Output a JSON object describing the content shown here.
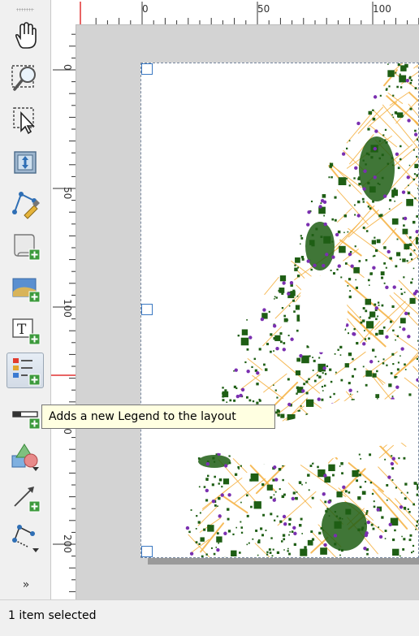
{
  "toolbar": {
    "tools": [
      {
        "name": "pan-icon",
        "active": false
      },
      {
        "name": "zoom-icon",
        "active": false
      },
      {
        "name": "select-move-icon",
        "active": false
      },
      {
        "name": "move-item-content-icon",
        "active": false
      },
      {
        "name": "edit-nodes-icon",
        "active": false
      },
      {
        "name": "add-map-icon",
        "active": false
      },
      {
        "name": "add-picture-icon",
        "active": false
      },
      {
        "name": "add-label-icon",
        "active": false
      },
      {
        "name": "add-legend-icon",
        "active": true
      },
      {
        "name": "add-scalebar-icon",
        "active": false
      },
      {
        "name": "add-shape-icon",
        "active": false
      },
      {
        "name": "add-arrow-icon",
        "active": false
      },
      {
        "name": "add-node-item-icon",
        "active": false
      }
    ],
    "more_label": "»"
  },
  "rulers": {
    "horizontal_labels": [
      "0",
      "50",
      "100"
    ],
    "vertical_labels": [
      "0",
      "50",
      "100",
      "150",
      "200"
    ]
  },
  "tooltip": {
    "text": "Adds a new Legend to the layout"
  },
  "status": {
    "text": "1 item selected"
  },
  "colors": {
    "accent": "#3a78c2",
    "map_green": "#1e5e14",
    "map_orange": "#f5b040",
    "map_purple": "#7a2fb0",
    "ruler_marker": "#e03030"
  }
}
